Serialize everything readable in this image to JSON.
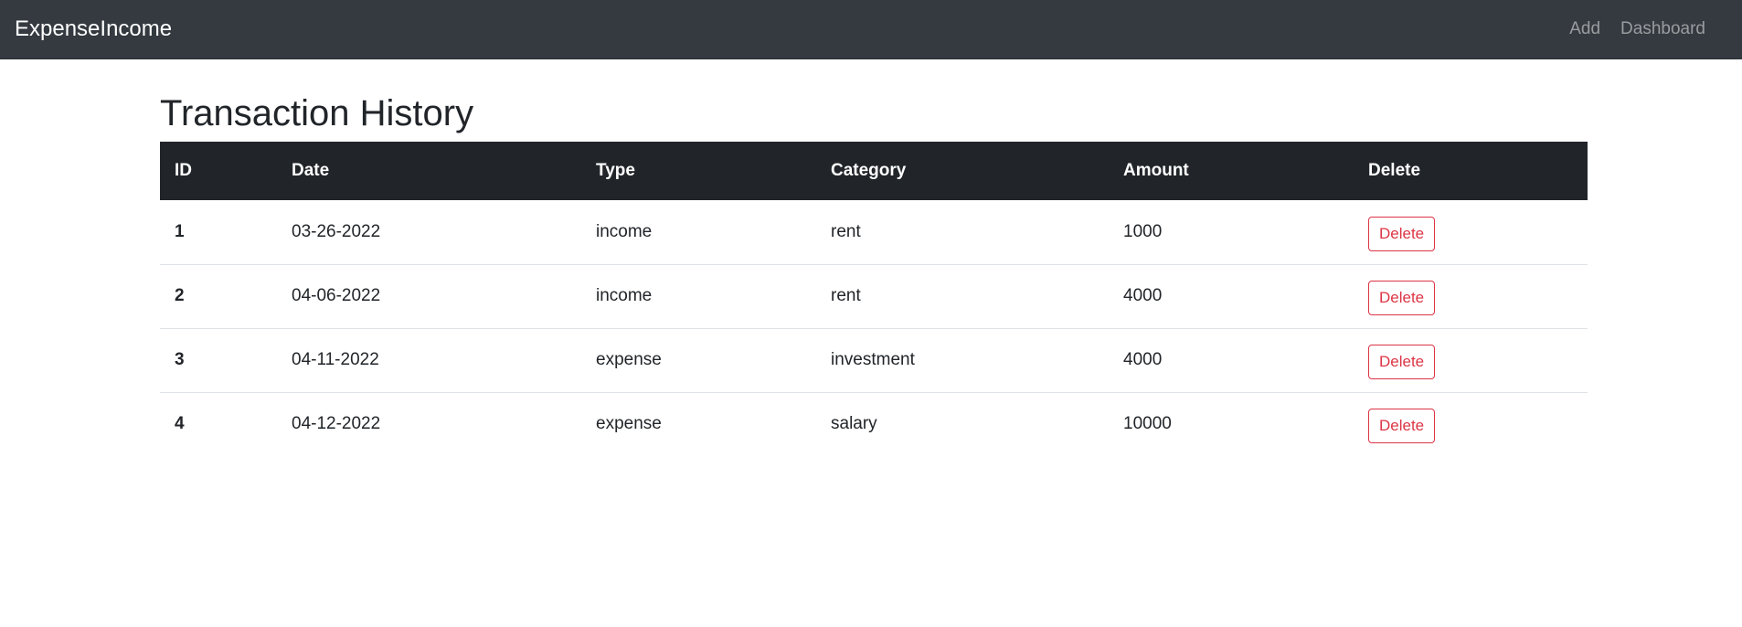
{
  "navbar": {
    "brand": "ExpenseIncome",
    "links": [
      "Add",
      "Dashboard"
    ]
  },
  "main": {
    "title": "Transaction History",
    "table": {
      "headers": [
        "ID",
        "Date",
        "Type",
        "Category",
        "Amount",
        "Delete"
      ],
      "rows": [
        {
          "id": "1",
          "date": "03-26-2022",
          "type": "income",
          "category": "rent",
          "amount": "1000",
          "action": "Delete"
        },
        {
          "id": "2",
          "date": "04-06-2022",
          "type": "income",
          "category": "rent",
          "amount": "4000",
          "action": "Delete"
        },
        {
          "id": "3",
          "date": "04-11-2022",
          "type": "expense",
          "category": "investment",
          "amount": "4000",
          "action": "Delete"
        },
        {
          "id": "4",
          "date": "04-12-2022",
          "type": "expense",
          "category": "salary",
          "amount": "10000",
          "action": "Delete"
        }
      ]
    }
  },
  "colors": {
    "navbar_bg": "#343a40",
    "table_header_bg": "#212529",
    "danger": "#dc3545"
  }
}
